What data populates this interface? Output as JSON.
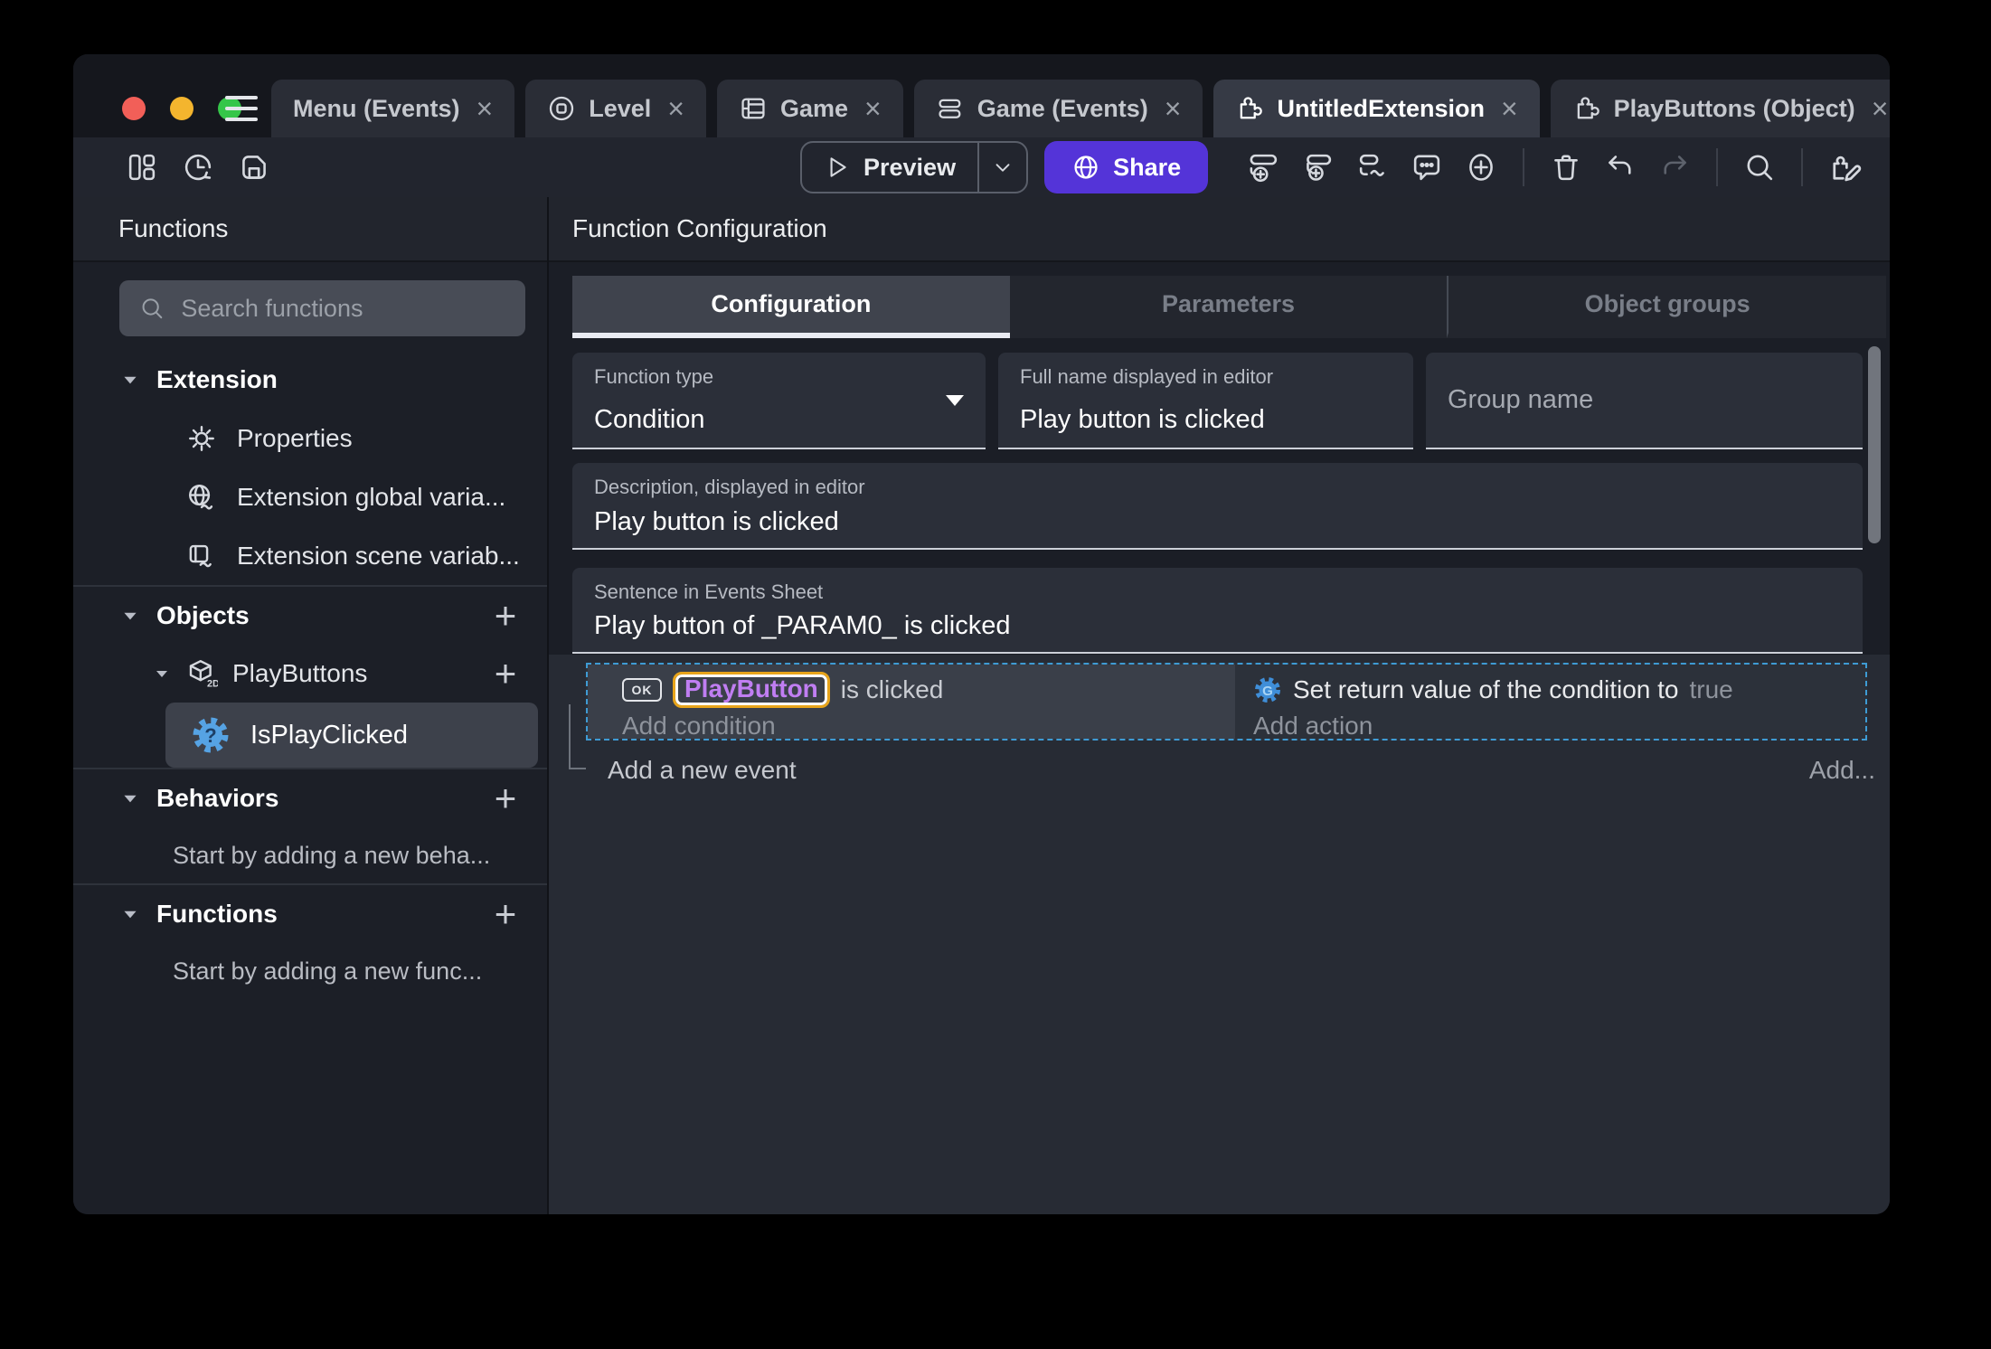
{
  "glyphs": {
    "close": "×",
    "plus": "+",
    "ok": "OK"
  },
  "window_tabs": [
    {
      "label": "Menu (Events)",
      "icon": "none"
    },
    {
      "label": "Level",
      "icon": "scene-icon"
    },
    {
      "label": "Game",
      "icon": "film-icon"
    },
    {
      "label": "Game (Events)",
      "icon": "events-sheet-icon"
    },
    {
      "label": "UntitledExtension",
      "icon": "puzzle-icon",
      "active": true
    },
    {
      "label": "PlayButtons (Object)",
      "icon": "puzzle-icon"
    }
  ],
  "toolbar": {
    "preview_label": "Preview",
    "share_label": "Share",
    "left_icons": [
      "layout-panels-icon",
      "history-clock-icon",
      "save-icon"
    ],
    "right_icons": [
      "add-event-icon",
      "add-subevent-icon",
      "add-other-event-icon",
      "comment-icon",
      "circle-plus-icon",
      "trash-icon",
      "undo-icon",
      "redo-icon",
      "search-icon",
      "edit-extension-icon"
    ]
  },
  "colors": {
    "share_purple": "#5434d8",
    "object_purple": "#c07ef2",
    "chip_orange": "#e7a41b",
    "selection_blue": "#3e9bd4",
    "function_icon_blue": "#56a3e4",
    "traffic_red": "#f25f58",
    "traffic_yellow": "#f4b52e",
    "traffic_green": "#35c649"
  },
  "sidebar": {
    "header": "Functions",
    "search_placeholder": "Search functions",
    "extension": {
      "label": "Extension",
      "items": [
        {
          "label": "Properties",
          "icon": "gear-icon"
        },
        {
          "label": "Extension global varia...",
          "icon": "globe-variable-icon"
        },
        {
          "label": "Extension scene variab...",
          "icon": "scene-variable-icon"
        }
      ]
    },
    "objects": {
      "label": "Objects",
      "object_label": "PlayButtons",
      "function_label": "IsPlayClicked"
    },
    "behaviors": {
      "label": "Behaviors",
      "hint": "Start by adding a new beha..."
    },
    "functions": {
      "label": "Functions",
      "hint": "Start by adding a new func..."
    }
  },
  "main": {
    "header": "Function Configuration",
    "tabs": [
      {
        "label": "Configuration",
        "active": true
      },
      {
        "label": "Parameters"
      },
      {
        "label": "Object groups"
      }
    ],
    "fields": {
      "function_type": {
        "label": "Function type",
        "value": "Condition"
      },
      "full_name": {
        "label": "Full name displayed in editor",
        "value": "Play button is clicked"
      },
      "group_name": {
        "placeholder": "Group name"
      },
      "description": {
        "label": "Description, displayed in editor",
        "value": "Play button is clicked"
      },
      "sentence": {
        "label": "Sentence in Events Sheet",
        "value": "Play button of _PARAM0_ is clicked"
      }
    },
    "events": {
      "condition": {
        "object": "PlayButton",
        "text": "is clicked",
        "add": "Add condition"
      },
      "action": {
        "text": "Set return value of the condition to",
        "value": "true",
        "add": "Add action"
      },
      "add_new_event": "Add a new event",
      "add_more": "Add..."
    }
  }
}
